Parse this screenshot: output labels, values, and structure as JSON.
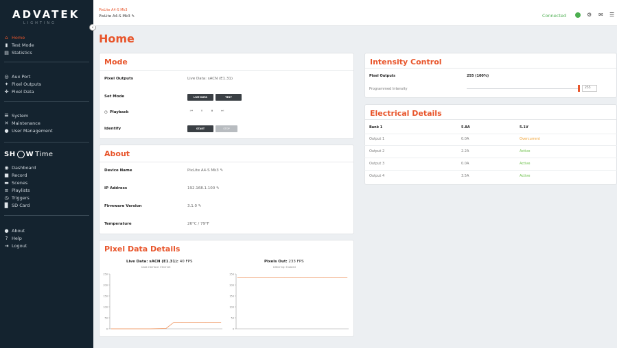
{
  "brand": {
    "name": "ADVATEK",
    "sub": "LIGHTING"
  },
  "device": {
    "model_line": "PixLite A4-S Mk3",
    "name_line": "PixLite A4-S Mk3 ✎"
  },
  "status": {
    "label": "Connected",
    "color": "#4caf50"
  },
  "sidebar": {
    "items": [
      {
        "label": "Home",
        "icon": "home-icon"
      },
      {
        "label": "Test Mode",
        "icon": "flask-icon"
      },
      {
        "label": "Statistics",
        "icon": "stats-icon"
      },
      {
        "label": "Aux Port",
        "icon": "plug-icon"
      },
      {
        "label": "Pixel Outputs",
        "icon": "bulb-icon"
      },
      {
        "label": "Pixel Data",
        "icon": "network-icon"
      },
      {
        "label": "System",
        "icon": "sliders-icon"
      },
      {
        "label": "Maintenance",
        "icon": "tools-icon"
      },
      {
        "label": "User Management",
        "icon": "user-icon"
      }
    ],
    "showtime": {
      "a": "SH",
      "b": "W",
      "c": "Time"
    },
    "showtime_items": [
      {
        "label": "Dashboard",
        "icon": "dashboard-icon"
      },
      {
        "label": "Record",
        "icon": "record-icon"
      },
      {
        "label": "Scenes",
        "icon": "scenes-icon"
      },
      {
        "label": "Playlists",
        "icon": "playlist-icon"
      },
      {
        "label": "Triggers",
        "icon": "trigger-icon"
      },
      {
        "label": "SD Card",
        "icon": "sdcard-icon"
      }
    ],
    "bottom_items": [
      {
        "label": "About",
        "icon": "info-icon"
      },
      {
        "label": "Help",
        "icon": "help-icon"
      },
      {
        "label": "Logout",
        "icon": "logout-icon"
      }
    ]
  },
  "page_title": "Home",
  "mode": {
    "title": "Mode",
    "pixel_outputs_label": "Pixel Outputs",
    "pixel_outputs_value": "Live Data: sACN (E1.31)",
    "set_mode_label": "Set Mode",
    "set_mode_buttons": [
      "LIVE DATA",
      "TEST"
    ],
    "playback_label": "Playback",
    "playback_controls": [
      "⏮",
      "⏸",
      "⏹",
      "⏭"
    ],
    "identify_label": "Identify",
    "identify_buttons": [
      "START",
      "STOP"
    ]
  },
  "about": {
    "title": "About",
    "rows": [
      {
        "label": "Device Name",
        "value": "PixLite A4-S Mk3 ✎"
      },
      {
        "label": "IP Address",
        "value": "192.168.1.100 ✎"
      },
      {
        "label": "Firmware Version",
        "value": "3.1.0 ✎"
      },
      {
        "label": "Temperature",
        "value": "26°C / 79°F"
      }
    ]
  },
  "pixel_data": {
    "title": "Pixel Data Details",
    "left_heading_bold": "Live Data: sACN (E1.31):",
    "left_heading_rest": " 40 FPS",
    "left_sub": "Data Interface: Ethernet",
    "right_heading_bold": "Pixels Out:",
    "right_heading_rest": " 233 FPS",
    "right_sub": "Dithering: Enabled"
  },
  "intensity": {
    "title": "Intensity Control",
    "pixel_outputs_label": "Pixel Outputs",
    "pixel_outputs_value": "255 (100%)",
    "programmed_label": "Programmed Intensity",
    "programmed_value": "255",
    "level": 1.0
  },
  "electrical": {
    "title": "Electrical Details",
    "headers": [
      "Bank 1",
      "5.8A",
      "5.1V"
    ],
    "rows": [
      {
        "name": "Output 1",
        "current": "0.0A",
        "status": "Overcurrent",
        "status_color": "#f0a030"
      },
      {
        "name": "Output 2",
        "current": "2.2A",
        "status": "Active",
        "status_color": "#6cc04a"
      },
      {
        "name": "Output 3",
        "current": "0.0A",
        "status": "Active",
        "status_color": "#6cc04a"
      },
      {
        "name": "Output 4",
        "current": "3.5A",
        "status": "Active",
        "status_color": "#6cc04a"
      }
    ]
  },
  "chart_data": [
    {
      "type": "line",
      "title": "Live Data: sACN (E1.31): 40 FPS",
      "ylim": [
        0,
        250
      ],
      "y_ticks": [
        "250",
        "200",
        "150",
        "100",
        "50",
        "0"
      ],
      "series": [
        {
          "values": [
            0,
            0,
            0,
            0,
            0,
            0,
            1,
            2,
            30,
            30,
            30,
            30,
            30,
            30,
            30
          ]
        }
      ]
    },
    {
      "type": "line",
      "title": "Pixels Out: 233 FPS",
      "ylim": [
        0,
        250
      ],
      "y_ticks": [
        "250",
        "200",
        "150",
        "100",
        "50",
        "0"
      ],
      "series": [
        {
          "values": [
            233,
            233,
            233,
            233,
            233,
            233,
            233,
            233,
            233,
            233,
            233,
            233,
            233,
            233,
            233
          ]
        }
      ]
    }
  ]
}
